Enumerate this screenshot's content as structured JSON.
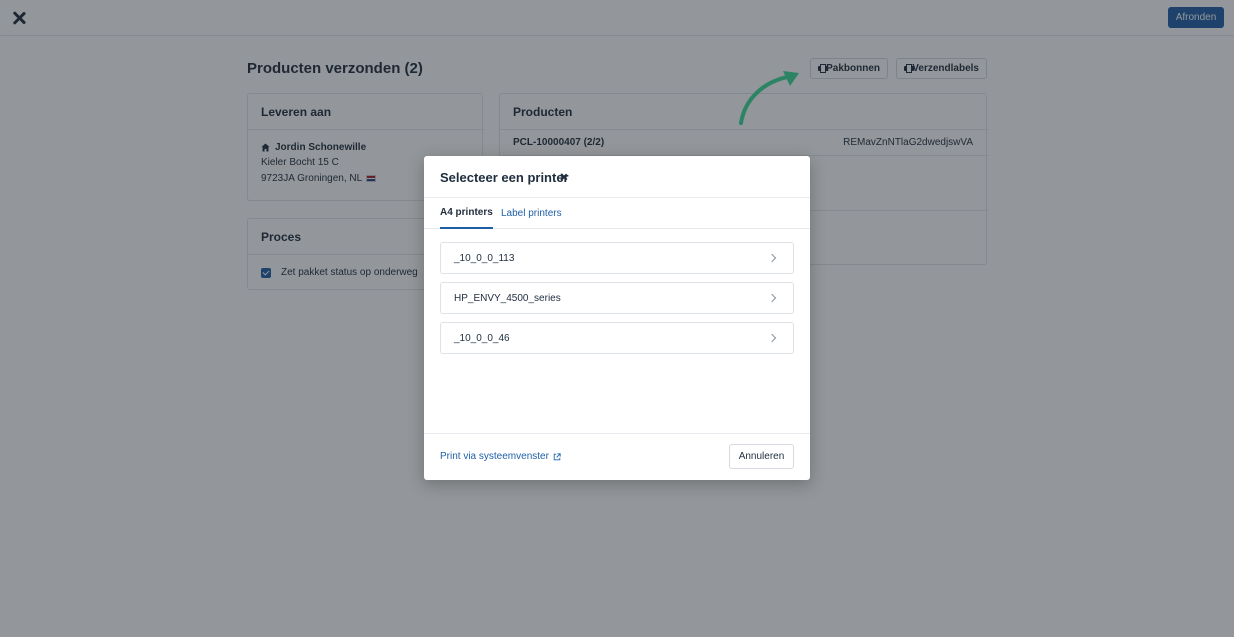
{
  "topbar": {
    "finish_label": "Afronden"
  },
  "page": {
    "title": "Producten verzonden (2)",
    "buttons": {
      "pakbonnen": "Pakbonnen",
      "verzendlabels": "Verzendlabels"
    }
  },
  "deliver": {
    "title": "Leveren aan",
    "name": "Jordin Schonewille",
    "street": "Kieler Bocht 15 C",
    "city": "9723JA Groningen, NL"
  },
  "process": {
    "title": "Proces",
    "checkbox_label": "Zet pakket status op onderweg",
    "checked": true
  },
  "products": {
    "title": "Producten",
    "order_id": "PCL-10000407 (2/2)",
    "reference": "REMavZnNTlaG2dwedjswVA"
  },
  "modal": {
    "title": "Selecteer een printer",
    "tabs": [
      {
        "label": "A4 printers",
        "active": true
      },
      {
        "label": "Label printers",
        "active": false
      }
    ],
    "printers": [
      "_10_0_0_113",
      "HP_ENVY_4500_series",
      "_10_0_0_46"
    ],
    "print_link": "Print via systeemvenster",
    "cancel_label": "Annuleren"
  },
  "colors": {
    "primary": "#1f5fa8",
    "text": "#1f2d3d",
    "arrow": "#3ddc97",
    "overlay": "rgba(30,36,44,0.48)"
  },
  "icons": [
    "close-icon",
    "printer-icon",
    "home-icon",
    "flag-nl-icon",
    "checkbox-icon",
    "chevron-right-icon",
    "external-link-icon",
    "arrow-annotation"
  ]
}
